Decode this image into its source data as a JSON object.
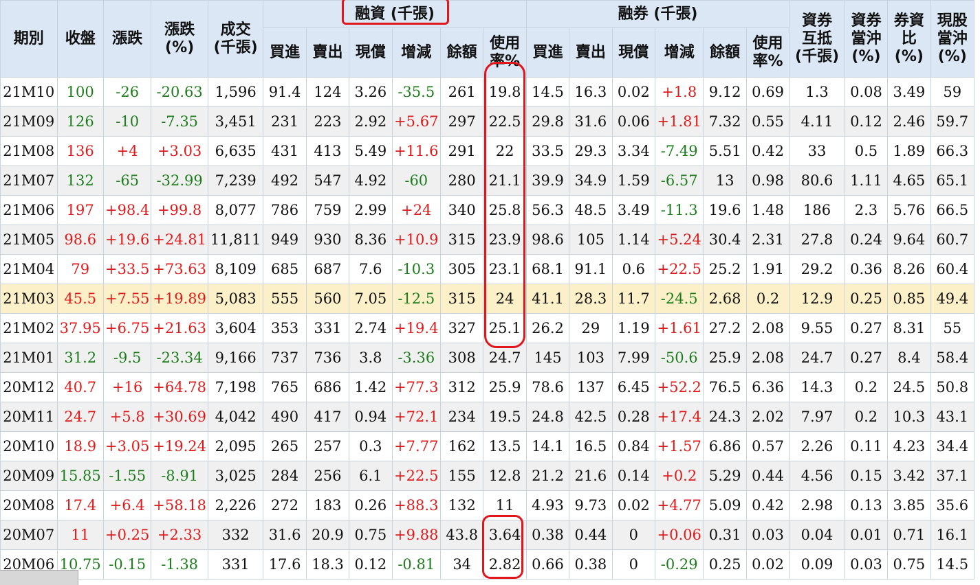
{
  "headers": {
    "period": "期別",
    "close": "收盤",
    "change": "漲跌",
    "change_pct": "漲跌\n(%)",
    "volume": "成交\n(千張)",
    "margin_group": "融資 (千張)",
    "short_group": "融券 (千張)",
    "buy": "買進",
    "sell": "賣出",
    "repay": "現償",
    "net_change": "增減",
    "balance": "餘額",
    "usage": "使用\n率%",
    "offset": "資券\n互抵\n(千張)",
    "daytrade": "資券\n當沖\n(%)",
    "short_margin_ratio": "券資\n比\n(%)",
    "cash_daytrade": "現股\n當沖\n(%)"
  },
  "colors": {
    "up": "#dd1b1b",
    "down": "#1d7d1d",
    "annotation": "#e0161c",
    "highlight_row": "#fcf0c9",
    "header_bg": "#dbe7f4"
  },
  "rows": [
    {
      "period": "21M10",
      "close": "100",
      "change": "-26",
      "change_pct": "-20.63",
      "volume": "1,596",
      "m_buy": "91.4",
      "m_sell": "124",
      "m_repay": "3.26",
      "m_net": "-35.5",
      "m_balance": "261",
      "m_usage": "19.8",
      "s_buy": "14.5",
      "s_sell": "16.3",
      "s_repay": "0.02",
      "s_net": "+1.8",
      "s_balance": "9.12",
      "s_usage": "0.69",
      "offset": "1.3",
      "daytrade": "0.08",
      "ratio": "3.49",
      "cash_dt": "59"
    },
    {
      "period": "21M09",
      "close": "126",
      "change": "-10",
      "change_pct": "-7.35",
      "volume": "3,451",
      "m_buy": "231",
      "m_sell": "223",
      "m_repay": "2.92",
      "m_net": "+5.67",
      "m_balance": "297",
      "m_usage": "22.5",
      "s_buy": "29.8",
      "s_sell": "31.6",
      "s_repay": "0.06",
      "s_net": "+1.81",
      "s_balance": "7.32",
      "s_usage": "0.55",
      "offset": "4.11",
      "daytrade": "0.12",
      "ratio": "2.46",
      "cash_dt": "59.7"
    },
    {
      "period": "21M08",
      "close": "136",
      "change": "+4",
      "change_pct": "+3.03",
      "volume": "6,635",
      "m_buy": "431",
      "m_sell": "413",
      "m_repay": "5.49",
      "m_net": "+11.6",
      "m_balance": "291",
      "m_usage": "22",
      "s_buy": "33.5",
      "s_sell": "29.3",
      "s_repay": "3.34",
      "s_net": "-7.49",
      "s_balance": "5.51",
      "s_usage": "0.42",
      "offset": "33",
      "daytrade": "0.5",
      "ratio": "1.89",
      "cash_dt": "66.3"
    },
    {
      "period": "21M07",
      "close": "132",
      "change": "-65",
      "change_pct": "-32.99",
      "volume": "7,239",
      "m_buy": "492",
      "m_sell": "547",
      "m_repay": "4.92",
      "m_net": "-60",
      "m_balance": "280",
      "m_usage": "21.1",
      "s_buy": "39.9",
      "s_sell": "34.9",
      "s_repay": "1.59",
      "s_net": "-6.57",
      "s_balance": "13",
      "s_usage": "0.98",
      "offset": "80.6",
      "daytrade": "1.11",
      "ratio": "4.65",
      "cash_dt": "65.1"
    },
    {
      "period": "21M06",
      "close": "197",
      "change": "+98.4",
      "change_pct": "+99.8",
      "volume": "8,077",
      "m_buy": "786",
      "m_sell": "759",
      "m_repay": "2.99",
      "m_net": "+24",
      "m_balance": "340",
      "m_usage": "25.8",
      "s_buy": "56.3",
      "s_sell": "48.5",
      "s_repay": "3.49",
      "s_net": "-11.3",
      "s_balance": "19.6",
      "s_usage": "1.48",
      "offset": "186",
      "daytrade": "2.3",
      "ratio": "5.76",
      "cash_dt": "66.5"
    },
    {
      "period": "21M05",
      "close": "98.6",
      "change": "+19.6",
      "change_pct": "+24.81",
      "volume": "11,811",
      "m_buy": "949",
      "m_sell": "930",
      "m_repay": "8.36",
      "m_net": "+10.9",
      "m_balance": "315",
      "m_usage": "23.9",
      "s_buy": "98.6",
      "s_sell": "105",
      "s_repay": "1.14",
      "s_net": "+5.24",
      "s_balance": "30.4",
      "s_usage": "2.31",
      "offset": "27.8",
      "daytrade": "0.24",
      "ratio": "9.64",
      "cash_dt": "60.7"
    },
    {
      "period": "21M04",
      "close": "79",
      "change": "+33.5",
      "change_pct": "+73.63",
      "volume": "8,109",
      "m_buy": "685",
      "m_sell": "687",
      "m_repay": "7.6",
      "m_net": "-10.3",
      "m_balance": "305",
      "m_usage": "23.1",
      "s_buy": "68.1",
      "s_sell": "91.1",
      "s_repay": "0.6",
      "s_net": "+22.5",
      "s_balance": "25.2",
      "s_usage": "1.91",
      "offset": "29.2",
      "daytrade": "0.36",
      "ratio": "8.26",
      "cash_dt": "60.4"
    },
    {
      "period": "21M03",
      "close": "45.5",
      "change": "+7.55",
      "change_pct": "+19.89",
      "volume": "5,083",
      "m_buy": "555",
      "m_sell": "560",
      "m_repay": "7.05",
      "m_net": "-12.5",
      "m_balance": "315",
      "m_usage": "24",
      "s_buy": "41.1",
      "s_sell": "28.3",
      "s_repay": "11.7",
      "s_net": "-24.5",
      "s_balance": "2.68",
      "s_usage": "0.2",
      "offset": "12.9",
      "daytrade": "0.25",
      "ratio": "0.85",
      "cash_dt": "49.4"
    },
    {
      "period": "21M02",
      "close": "37.95",
      "change": "+6.75",
      "change_pct": "+21.63",
      "volume": "3,604",
      "m_buy": "353",
      "m_sell": "331",
      "m_repay": "2.74",
      "m_net": "+19.4",
      "m_balance": "327",
      "m_usage": "25.1",
      "s_buy": "26.2",
      "s_sell": "29",
      "s_repay": "1.19",
      "s_net": "+1.61",
      "s_balance": "27.2",
      "s_usage": "2.08",
      "offset": "9.55",
      "daytrade": "0.27",
      "ratio": "8.31",
      "cash_dt": "55"
    },
    {
      "period": "21M01",
      "close": "31.2",
      "change": "-9.5",
      "change_pct": "-23.34",
      "volume": "9,166",
      "m_buy": "737",
      "m_sell": "736",
      "m_repay": "3.8",
      "m_net": "-3.36",
      "m_balance": "308",
      "m_usage": "24.7",
      "s_buy": "145",
      "s_sell": "103",
      "s_repay": "7.99",
      "s_net": "-50.6",
      "s_balance": "25.9",
      "s_usage": "2.08",
      "offset": "24.7",
      "daytrade": "0.27",
      "ratio": "8.4",
      "cash_dt": "58.4"
    },
    {
      "period": "20M12",
      "close": "40.7",
      "change": "+16",
      "change_pct": "+64.78",
      "volume": "7,198",
      "m_buy": "765",
      "m_sell": "686",
      "m_repay": "1.42",
      "m_net": "+77.3",
      "m_balance": "312",
      "m_usage": "25.9",
      "s_buy": "78.6",
      "s_sell": "137",
      "s_repay": "6.45",
      "s_net": "+52.2",
      "s_balance": "76.5",
      "s_usage": "6.36",
      "offset": "14.3",
      "daytrade": "0.2",
      "ratio": "24.5",
      "cash_dt": "50.8"
    },
    {
      "period": "20M11",
      "close": "24.7",
      "change": "+5.8",
      "change_pct": "+30.69",
      "volume": "4,042",
      "m_buy": "490",
      "m_sell": "417",
      "m_repay": "0.94",
      "m_net": "+72.1",
      "m_balance": "234",
      "m_usage": "19.5",
      "s_buy": "24.8",
      "s_sell": "42.5",
      "s_repay": "0.28",
      "s_net": "+17.4",
      "s_balance": "24.3",
      "s_usage": "2.02",
      "offset": "7.97",
      "daytrade": "0.2",
      "ratio": "10.3",
      "cash_dt": "43.1"
    },
    {
      "period": "20M10",
      "close": "18.9",
      "change": "+3.05",
      "change_pct": "+19.24",
      "volume": "2,095",
      "m_buy": "265",
      "m_sell": "257",
      "m_repay": "0.3",
      "m_net": "+7.77",
      "m_balance": "162",
      "m_usage": "13.5",
      "s_buy": "14.1",
      "s_sell": "16.5",
      "s_repay": "0.84",
      "s_net": "+1.57",
      "s_balance": "6.86",
      "s_usage": "0.57",
      "offset": "2.26",
      "daytrade": "0.11",
      "ratio": "4.23",
      "cash_dt": "34.4"
    },
    {
      "period": "20M09",
      "close": "15.85",
      "change": "-1.55",
      "change_pct": "-8.91",
      "volume": "3,025",
      "m_buy": "284",
      "m_sell": "256",
      "m_repay": "6.1",
      "m_net": "+22.5",
      "m_balance": "155",
      "m_usage": "12.8",
      "s_buy": "21.2",
      "s_sell": "21.6",
      "s_repay": "0.14",
      "s_net": "+0.2",
      "s_balance": "5.29",
      "s_usage": "0.44",
      "offset": "4.56",
      "daytrade": "0.15",
      "ratio": "3.42",
      "cash_dt": "37.1"
    },
    {
      "period": "20M08",
      "close": "17.4",
      "change": "+6.4",
      "change_pct": "+58.18",
      "volume": "2,226",
      "m_buy": "272",
      "m_sell": "183",
      "m_repay": "0.26",
      "m_net": "+88.3",
      "m_balance": "132",
      "m_usage": "11",
      "s_buy": "4.93",
      "s_sell": "9.73",
      "s_repay": "0.02",
      "s_net": "+4.77",
      "s_balance": "5.09",
      "s_usage": "0.42",
      "offset": "2.98",
      "daytrade": "0.13",
      "ratio": "3.85",
      "cash_dt": "35.6"
    },
    {
      "period": "20M07",
      "close": "11",
      "change": "+0.25",
      "change_pct": "+2.33",
      "volume": "332",
      "m_buy": "31.6",
      "m_sell": "20.9",
      "m_repay": "0.75",
      "m_net": "+9.88",
      "m_balance": "43.8",
      "m_usage": "3.64",
      "s_buy": "0.38",
      "s_sell": "0.44",
      "s_repay": "0",
      "s_net": "+0.06",
      "s_balance": "0.31",
      "s_usage": "0.03",
      "offset": "0.04",
      "daytrade": "0.01",
      "ratio": "0.71",
      "cash_dt": "16.1"
    },
    {
      "period": "20M06",
      "close": "10.75",
      "change": "-0.15",
      "change_pct": "-1.38",
      "volume": "331",
      "m_buy": "17.6",
      "m_sell": "18.3",
      "m_repay": "0.12",
      "m_net": "-0.81",
      "m_balance": "34",
      "m_usage": "2.82",
      "s_buy": "0.66",
      "s_sell": "0.38",
      "s_repay": "0",
      "s_net": "-0.29",
      "s_balance": "0.25",
      "s_usage": "0.02",
      "offset": "0.09",
      "daytrade": "0.03",
      "ratio": "0.75",
      "cash_dt": "14.5"
    }
  ]
}
